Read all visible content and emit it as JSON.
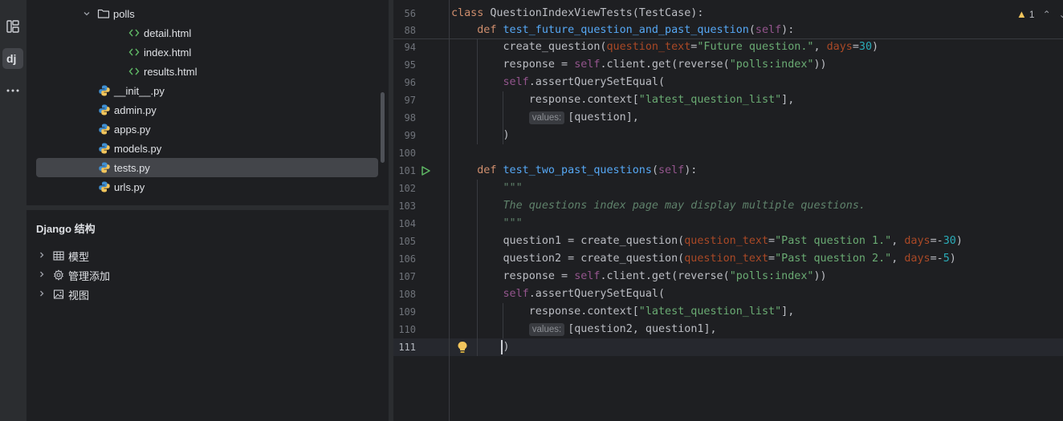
{
  "project_tree": {
    "items": [
      {
        "label": "polls",
        "icon": "folder-icon",
        "chevron": "expanded",
        "indent": 1
      },
      {
        "label": "detail.html",
        "icon": "html-icon",
        "indent": 2
      },
      {
        "label": "index.html",
        "icon": "html-icon",
        "indent": 2
      },
      {
        "label": "results.html",
        "icon": "html-icon",
        "indent": 2
      },
      {
        "label": "__init__.py",
        "icon": "python-icon",
        "indent": 0
      },
      {
        "label": "admin.py",
        "icon": "python-icon",
        "indent": 0
      },
      {
        "label": "apps.py",
        "icon": "python-icon",
        "indent": 0
      },
      {
        "label": "models.py",
        "icon": "python-icon",
        "indent": 0
      },
      {
        "label": "tests.py",
        "icon": "python-icon",
        "indent": 0,
        "selected": true
      },
      {
        "label": "urls.py",
        "icon": "python-icon",
        "indent": 0
      }
    ]
  },
  "django_panel": {
    "title": "Django 结构",
    "items": [
      {
        "label": "模型",
        "icon": "table-icon"
      },
      {
        "label": "管理添加",
        "icon": "gear-icon"
      },
      {
        "label": "视图",
        "icon": "image-icon"
      }
    ]
  },
  "editor": {
    "problems": {
      "warnings": "1"
    },
    "lines": [
      {
        "num": "56",
        "tokens": [
          [
            "kw",
            "class "
          ],
          [
            "",
            "QuestionIndexViewTests(TestCase):"
          ]
        ]
      },
      {
        "num": "88",
        "tokens": [
          [
            "",
            "    "
          ],
          [
            "kw",
            "def "
          ],
          [
            "fn",
            "test_future_question_and_past_question"
          ],
          [
            "",
            "("
          ],
          [
            "self",
            "self"
          ],
          [
            "",
            "):"
          ]
        ]
      },
      {
        "num": "94",
        "tokens": [
          [
            "",
            "        create_question("
          ],
          [
            "param",
            "question_text"
          ],
          [
            "",
            "="
          ],
          [
            "str",
            "\"Future question.\""
          ],
          [
            "",
            ", "
          ],
          [
            "param",
            "days"
          ],
          [
            "",
            "="
          ],
          [
            "num",
            "30"
          ],
          [
            "",
            ")"
          ]
        ]
      },
      {
        "num": "95",
        "tokens": [
          [
            "",
            "        response = "
          ],
          [
            "self",
            "self"
          ],
          [
            "",
            ".client.get(reverse("
          ],
          [
            "str",
            "\"polls:index\""
          ],
          [
            "",
            "))"
          ]
        ]
      },
      {
        "num": "96",
        "tokens": [
          [
            "",
            "        "
          ],
          [
            "self",
            "self"
          ],
          [
            "",
            ".assertQuerySetEqual("
          ]
        ]
      },
      {
        "num": "97",
        "tokens": [
          [
            "",
            "            response.context["
          ],
          [
            "str",
            "\"latest_question_list\""
          ],
          [
            "",
            "],"
          ]
        ]
      },
      {
        "num": "98",
        "hint": "values:",
        "tokens": [
          [
            "",
            "[question],"
          ]
        ]
      },
      {
        "num": "99",
        "tokens": [
          [
            "",
            "        )"
          ]
        ]
      },
      {
        "num": "100",
        "tokens": []
      },
      {
        "num": "101",
        "tokens": [
          [
            "",
            "    "
          ],
          [
            "kw",
            "def "
          ],
          [
            "fn",
            "test_two_past_questions"
          ],
          [
            "",
            "("
          ],
          [
            "self",
            "self"
          ],
          [
            "",
            "):"
          ]
        ]
      },
      {
        "num": "102",
        "tokens": [
          [
            "doc",
            "        \"\"\""
          ]
        ]
      },
      {
        "num": "103",
        "tokens": [
          [
            "doc",
            "        The questions index page may display multiple questions."
          ]
        ]
      },
      {
        "num": "104",
        "tokens": [
          [
            "doc",
            "        \"\"\""
          ]
        ]
      },
      {
        "num": "105",
        "tokens": [
          [
            "",
            "        question1 = create_question("
          ],
          [
            "param",
            "question_text"
          ],
          [
            "",
            "="
          ],
          [
            "str",
            "\"Past question 1.\""
          ],
          [
            "",
            ", "
          ],
          [
            "param",
            "days"
          ],
          [
            "",
            "=-"
          ],
          [
            "num",
            "30"
          ],
          [
            "",
            ")"
          ]
        ]
      },
      {
        "num": "106",
        "tokens": [
          [
            "",
            "        question2 = create_question("
          ],
          [
            "param",
            "question_text"
          ],
          [
            "",
            "="
          ],
          [
            "str",
            "\"Past question 2.\""
          ],
          [
            "",
            ", "
          ],
          [
            "param",
            "days"
          ],
          [
            "",
            "=-"
          ],
          [
            "num",
            "5"
          ],
          [
            "",
            ")"
          ]
        ]
      },
      {
        "num": "107",
        "tokens": [
          [
            "",
            "        response = "
          ],
          [
            "self",
            "self"
          ],
          [
            "",
            ".client.get(reverse("
          ],
          [
            "str",
            "\"polls:index\""
          ],
          [
            "",
            "))"
          ]
        ]
      },
      {
        "num": "108",
        "tokens": [
          [
            "",
            "        "
          ],
          [
            "self",
            "self"
          ],
          [
            "",
            ".assertQuerySetEqual("
          ]
        ]
      },
      {
        "num": "109",
        "tokens": [
          [
            "",
            "            response.context["
          ],
          [
            "str",
            "\"latest_question_list\""
          ],
          [
            "",
            "],"
          ]
        ]
      },
      {
        "num": "110",
        "hint": "values:",
        "tokens": [
          [
            "",
            "[question2, question1],"
          ]
        ]
      },
      {
        "num": "111",
        "current": true,
        "tokens": [
          [
            "",
            "        )"
          ]
        ]
      }
    ]
  },
  "colors": {
    "background": "#1e1f22",
    "keyword": "#cf8e6d",
    "function": "#56a8f5",
    "string": "#6aab73",
    "number": "#2aacb8",
    "self": "#94558d",
    "param": "#aa4926",
    "docstring": "#5f826b"
  }
}
